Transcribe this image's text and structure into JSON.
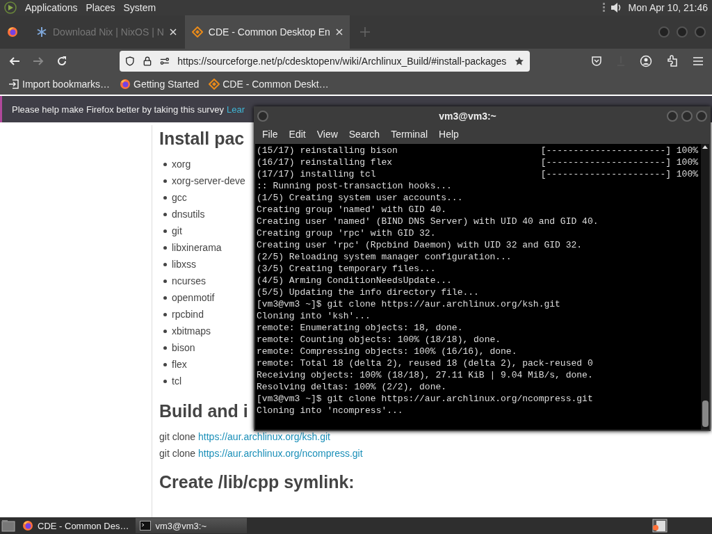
{
  "top_panel": {
    "menus": [
      "Applications",
      "Places",
      "System"
    ],
    "clock": "Mon Apr 10, 21:46"
  },
  "browser": {
    "tabs": [
      {
        "label": "Download Nix | NixOS | N",
        "selected": false
      },
      {
        "label": "CDE - Common Desktop En",
        "selected": true
      }
    ],
    "url": "https://sourceforge.net/p/cdesktopenv/wiki/Archlinux_Build/#install-packages",
    "bookmarks": [
      "Import bookmarks…",
      "Getting Started",
      "CDE - Common Deskt…"
    ],
    "notification": {
      "text": "Please help make Firefox better by taking this survey",
      "link": "Lear"
    },
    "page": {
      "heading_1": "Install pac",
      "packages": [
        "xorg",
        "xorg-server-deve",
        "gcc",
        "dnsutils",
        "git",
        "libxinerama",
        "libxss",
        "ncurses",
        "openmotif",
        "rpcbind",
        "xbitmaps",
        "bison",
        "flex",
        "tcl"
      ],
      "heading_2": "Build and i",
      "commands": [
        {
          "text": "git clone",
          "link": "https://aur.archlinux.org/ksh.git"
        },
        {
          "text": "git clone",
          "link": "https://aur.archlinux.org/ncompress.git"
        }
      ],
      "heading_3": "Create /lib/cpp symlink:"
    }
  },
  "terminal": {
    "title": "vm3@vm3:~",
    "menu": [
      "File",
      "Edit",
      "View",
      "Search",
      "Terminal",
      "Help"
    ],
    "lines": [
      {
        "text": "(15/17) reinstalling bison",
        "progress": "[----------------------] 100%"
      },
      {
        "text": "(16/17) reinstalling flex",
        "progress": "[----------------------] 100%"
      },
      {
        "text": "(17/17) installing tcl",
        "progress": "[----------------------] 100%"
      },
      {
        "text": ":: Running post-transaction hooks..."
      },
      {
        "text": "(1/5) Creating system user accounts..."
      },
      {
        "text": "Creating group 'named' with GID 40."
      },
      {
        "text": "Creating user 'named' (BIND DNS Server) with UID 40 and GID 40."
      },
      {
        "text": "Creating group 'rpc' with GID 32."
      },
      {
        "text": "Creating user 'rpc' (Rpcbind Daemon) with UID 32 and GID 32."
      },
      {
        "text": "(2/5) Reloading system manager configuration..."
      },
      {
        "text": "(3/5) Creating temporary files..."
      },
      {
        "text": "(4/5) Arming ConditionNeedsUpdate..."
      },
      {
        "text": "(5/5) Updating the info directory file..."
      },
      {
        "text": "[vm3@vm3 ~]$ git clone https://aur.archlinux.org/ksh.git"
      },
      {
        "text": "Cloning into 'ksh'..."
      },
      {
        "text": "remote: Enumerating objects: 18, done."
      },
      {
        "text": "remote: Counting objects: 100% (18/18), done."
      },
      {
        "text": "remote: Compressing objects: 100% (16/16), done."
      },
      {
        "text": "remote: Total 18 (delta 2), reused 18 (delta 2), pack-reused 0"
      },
      {
        "text": "Receiving objects: 100% (18/18), 27.11 KiB | 9.04 MiB/s, done."
      },
      {
        "text": "Resolving deltas: 100% (2/2), done."
      },
      {
        "text": "[vm3@vm3 ~]$ git clone https://aur.archlinux.org/ncompress.git"
      },
      {
        "text": "Cloning into 'ncompress'..."
      }
    ]
  },
  "taskbar": {
    "items": [
      {
        "label": "CDE - Common Des…",
        "selected": false
      },
      {
        "label": "vm3@vm3:~",
        "selected": true
      }
    ]
  }
}
